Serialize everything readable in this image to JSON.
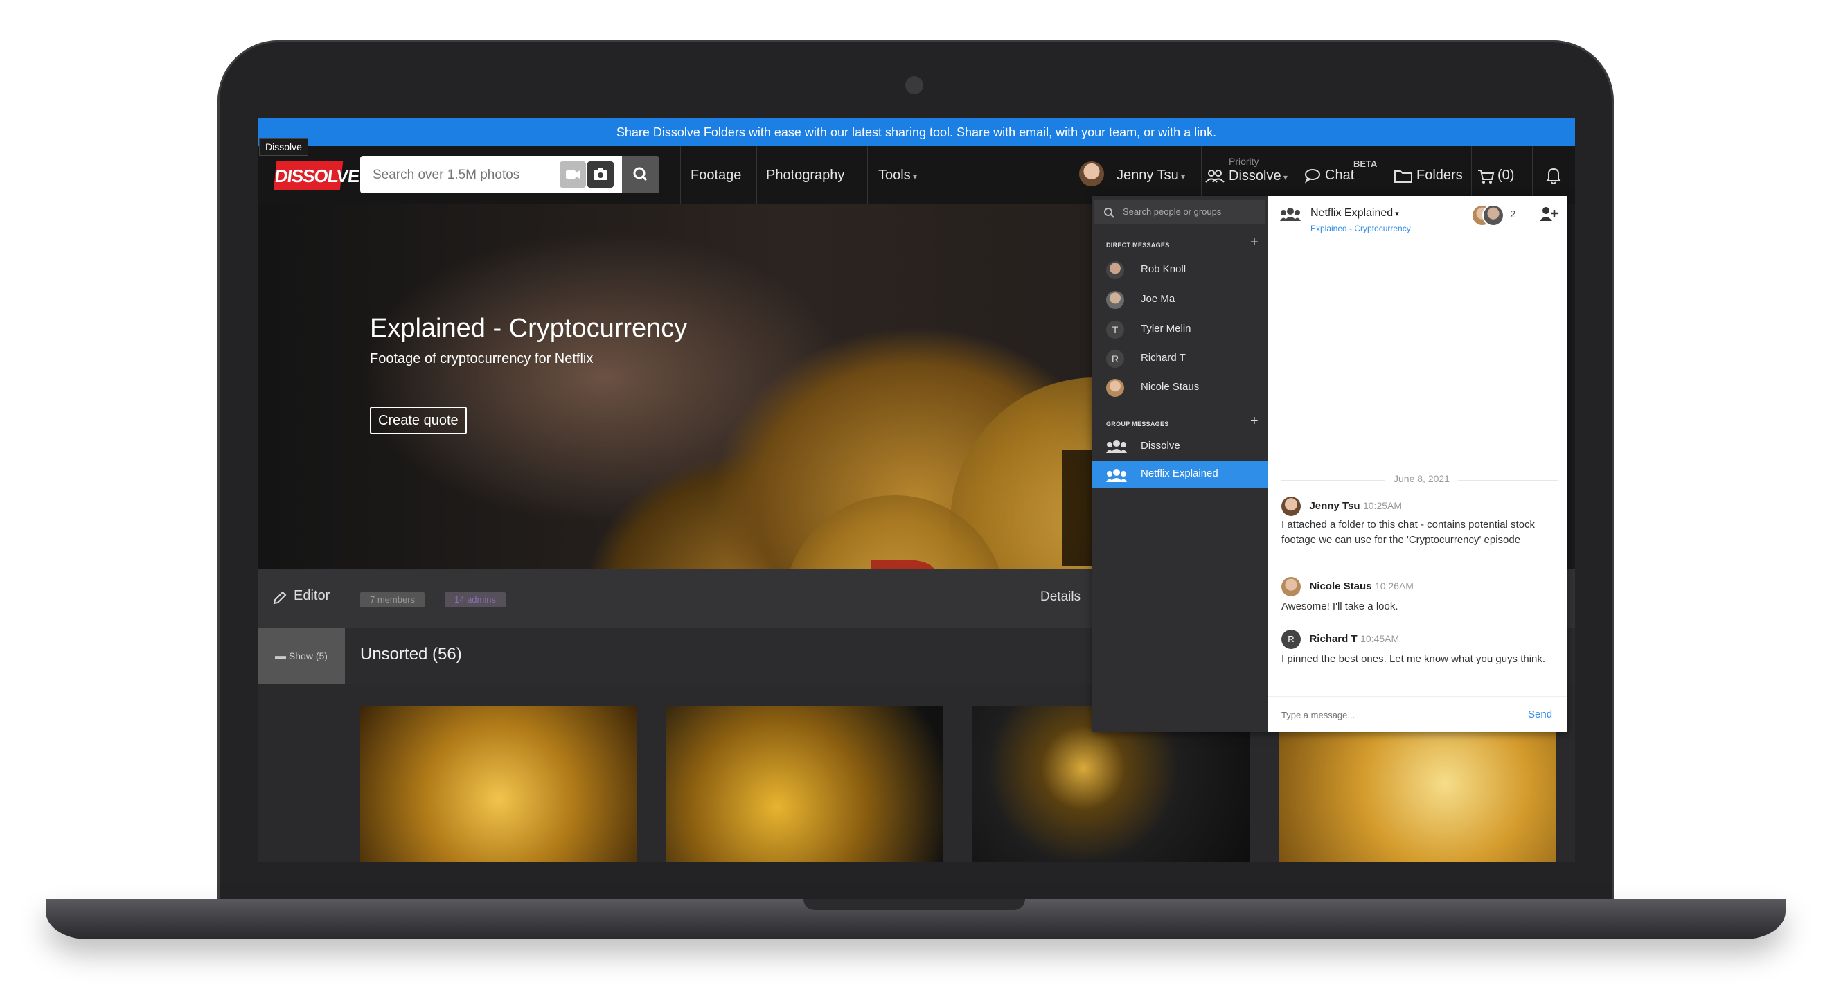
{
  "announcement": "Share Dissolve Folders with ease with our latest sharing tool. Share with email, with your team, or with a link.",
  "tooltip": "Dissolve",
  "logo_text": "DISSOLVE",
  "search": {
    "placeholder": "Search over 1.5M photos"
  },
  "nav": {
    "footage": "Footage",
    "photography": "Photography",
    "tools": "Tools",
    "user": "Jenny Tsu",
    "priority": "Priority",
    "priority_org": "Dissolve",
    "chat": "Chat",
    "chat_badge": "BETA",
    "folders": "Folders",
    "cart": "(0)"
  },
  "hero": {
    "title": "Explained - Cryptocurrency",
    "subtitle": "Footage of cryptocurrency for Netflix",
    "cta": "Create quote"
  },
  "editbar": {
    "editor": "Editor",
    "members": "7 members",
    "admins": "14 admins",
    "details": "Details"
  },
  "folder": {
    "show": "Show (5)",
    "title": "Unsorted (56)"
  },
  "chat": {
    "search_placeholder": "Search people or groups",
    "direct_heading": "DIRECT MESSAGES",
    "group_heading": "GROUP MESSAGES",
    "direct": [
      {
        "name": "Rob Knoll",
        "initial": ""
      },
      {
        "name": "Joe Ma",
        "initial": ""
      },
      {
        "name": "Tyler Melin",
        "initial": "T"
      },
      {
        "name": "Richard T",
        "initial": "R"
      },
      {
        "name": "Nicole Staus",
        "initial": ""
      }
    ],
    "groups": [
      {
        "name": "Dissolve"
      },
      {
        "name": "Netflix Explained"
      }
    ],
    "header": {
      "title": "Netflix Explained",
      "subtitle": "Explained - Cryptocurrency",
      "member_count": "2"
    },
    "date": "June 8, 2021",
    "messages": [
      {
        "name": "Jenny Tsu",
        "time": "10:25AM",
        "text": "I attached a folder to this chat - contains potential stock footage we can use for the 'Cryptocurrency' episode"
      },
      {
        "name": "Nicole Staus",
        "time": "10:26AM",
        "text": "Awesome! I'll take a look."
      },
      {
        "name": "Richard T",
        "time": "10:45AM",
        "text": "I pinned the best ones. Let me know what you guys think."
      }
    ],
    "reply_initial": "R",
    "input_placeholder": "Type a message...",
    "send": "Send"
  }
}
